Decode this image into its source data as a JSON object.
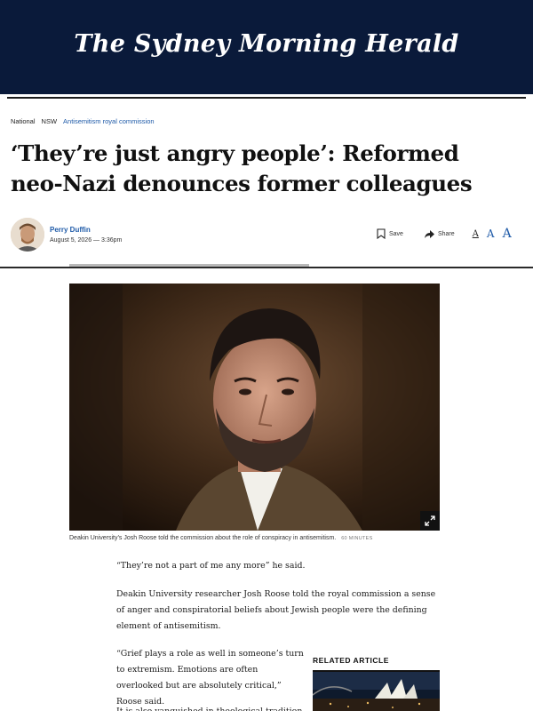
{
  "masthead": {
    "title": "The Sydney Morning Herald"
  },
  "breadcrumb": [
    "National",
    "NSW",
    "Antisemitism royal commission"
  ],
  "article": {
    "headline": "‘They’re just angry people’: Reformed neo-Nazi denounces former colleagues",
    "author": "Perry Duffin",
    "date": "August 5, 2026 — 3:36pm"
  },
  "tools": {
    "save_label": "Save",
    "share_label": "Share",
    "font_sizes": [
      "A",
      "A",
      "A"
    ]
  },
  "hero": {
    "caption": "Deakin University’s Josh Roose told the commission about the role of conspiracy in antisemitism.",
    "credit": "60 MINUTES"
  },
  "body": {
    "p1": "“They’re not a part of me any more” he said.",
    "p2": "Deakin University researcher Josh Roose told the royal commission a sense of anger and conspiratorial beliefs about Jewish people were the defining element of antisemitism.",
    "p3": "“Grief plays a role as well in someone’s turn to extremism. Emotions are often overlooked but are absolutely critical,” Roose said.",
    "p4": "It is also vanquished in theological tradition"
  },
  "related": {
    "label": "RELATED ARTICLE"
  },
  "colors": {
    "masthead_bg": "#0a1a3a",
    "link_blue": "#1e5aa8"
  }
}
